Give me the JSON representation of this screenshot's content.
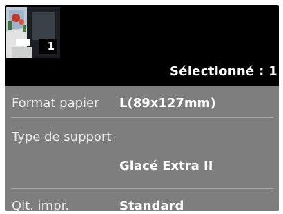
{
  "thumbnail": {
    "count": "1"
  },
  "header": {
    "selected_text": "Sélectionné : 1"
  },
  "settings": {
    "paper_size": {
      "label": "Format papier",
      "value": "L(89x127mm)"
    },
    "media_type": {
      "label": "Type de support",
      "value": "Glacé Extra II"
    },
    "print_quality": {
      "label": "Qlt. impr.",
      "value": "Standard"
    }
  }
}
